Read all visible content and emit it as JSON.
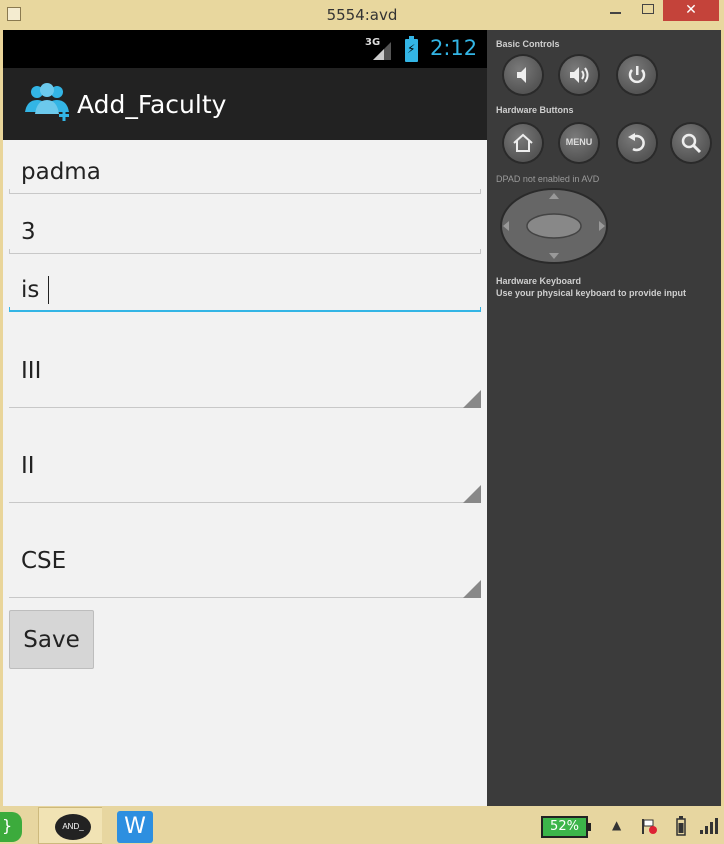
{
  "window": {
    "title": "5554:avd",
    "close_glyph": "✕"
  },
  "statusbar": {
    "network": "3G",
    "time": "2:12"
  },
  "actionbar": {
    "title": "Add_Faculty",
    "icon": "add-group-icon"
  },
  "form": {
    "name_value": "padma",
    "number_value": "3",
    "subject_value": "is",
    "spinner_1": "III",
    "spinner_2": "II",
    "spinner_3": "CSE",
    "save_label": "Save"
  },
  "controls": {
    "basic_controls_label": "Basic Controls",
    "hardware_buttons_label": "Hardware Buttons",
    "menu_label": "MENU",
    "dpad_label": "DPAD not enabled in AVD",
    "keyboard_label": "Hardware Keyboard",
    "keyboard_hint": "Use your physical keyboard to provide input"
  },
  "taskbar": {
    "battery_percent": "52%",
    "android_label": "AND_",
    "w_label": "W",
    "start_glyph": "}",
    "tray_up": "▲"
  },
  "colors": {
    "accent": "#33b5e5",
    "actionbar": "#222222",
    "panel": "#3b3b3b",
    "battery": "#3cb54a"
  }
}
